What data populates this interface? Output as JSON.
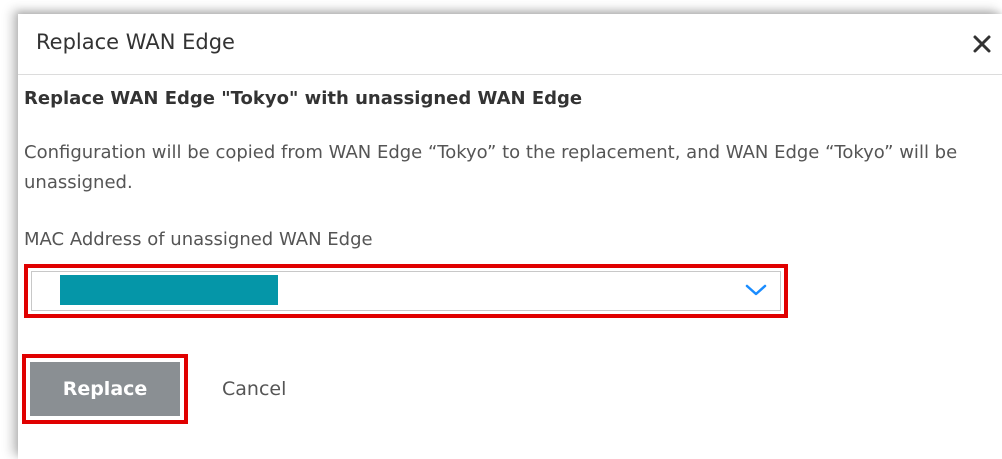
{
  "dialog": {
    "title": "Replace WAN Edge",
    "close_icon": "close-icon",
    "subtitle": "Replace WAN Edge \"Tokyo\" with unassigned WAN Edge",
    "description": "Configuration will be copied from WAN Edge “Tokyo” to the replacement, and WAN Edge “Tokyo” will be unassigned.",
    "mac_field": {
      "label": "MAC Address of unassigned WAN Edge",
      "selected_value": "",
      "dropdown_icon": "chevron-down-icon"
    },
    "buttons": {
      "replace_label": "Replace",
      "cancel_label": "Cancel"
    }
  },
  "colors": {
    "highlight": "#e00000",
    "replace_button_bg": "#8a8f93",
    "redaction": "#0596a8",
    "chevron": "#1a8cff"
  }
}
